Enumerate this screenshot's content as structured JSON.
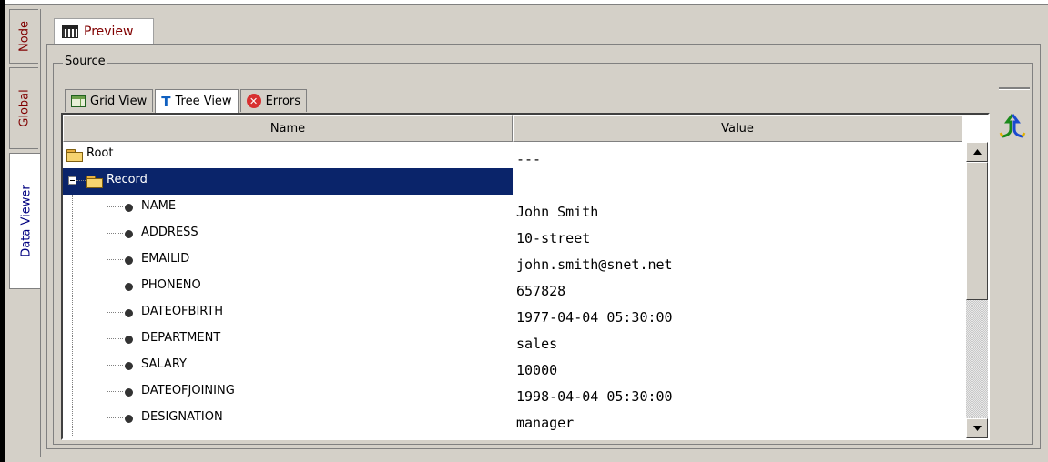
{
  "side_tabs": [
    {
      "label": "Node",
      "active": false
    },
    {
      "label": "Global",
      "active": false
    },
    {
      "label": "Data Viewer",
      "active": true
    }
  ],
  "preview_tab": {
    "label": "Preview",
    "icon": "grid-icon"
  },
  "source_group": {
    "label": "Source"
  },
  "inner_tabs": [
    {
      "label": "Grid View",
      "icon": "grid-view-icon",
      "active": false
    },
    {
      "label": "Tree View",
      "icon": "tree-view-icon",
      "active": true
    },
    {
      "label": "Errors",
      "icon": "error-icon",
      "active": false
    }
  ],
  "grid": {
    "columns": [
      "Name",
      "Value"
    ],
    "rows": [
      {
        "name": "Root",
        "value": "---",
        "kind": "folder",
        "level": 0
      },
      {
        "name": "Record",
        "value": "",
        "kind": "folder",
        "level": 1,
        "selected": true,
        "expanded": true
      },
      {
        "name": "NAME",
        "value": "John Smith",
        "kind": "field",
        "level": 2
      },
      {
        "name": "ADDRESS",
        "value": "10-street",
        "kind": "field",
        "level": 2
      },
      {
        "name": "EMAILID",
        "value": "john.smith@snet.net",
        "kind": "field",
        "level": 2
      },
      {
        "name": "PHONENO",
        "value": "657828",
        "kind": "field",
        "level": 2
      },
      {
        "name": "DATEOFBIRTH",
        "value": "1977-04-04 05:30:00",
        "kind": "field",
        "level": 2
      },
      {
        "name": "DEPARTMENT",
        "value": "sales",
        "kind": "field",
        "level": 2
      },
      {
        "name": "SALARY",
        "value": "10000",
        "kind": "field",
        "level": 2
      },
      {
        "name": "DATEOFJOINING",
        "value": "1998-04-04 05:30:00",
        "kind": "field",
        "level": 2
      },
      {
        "name": "DESIGNATION",
        "value": "manager",
        "kind": "field",
        "level": 2
      }
    ]
  },
  "colors": {
    "selection": "#0a246a",
    "tab_text": "#800000",
    "background": "#d4d0c8"
  }
}
